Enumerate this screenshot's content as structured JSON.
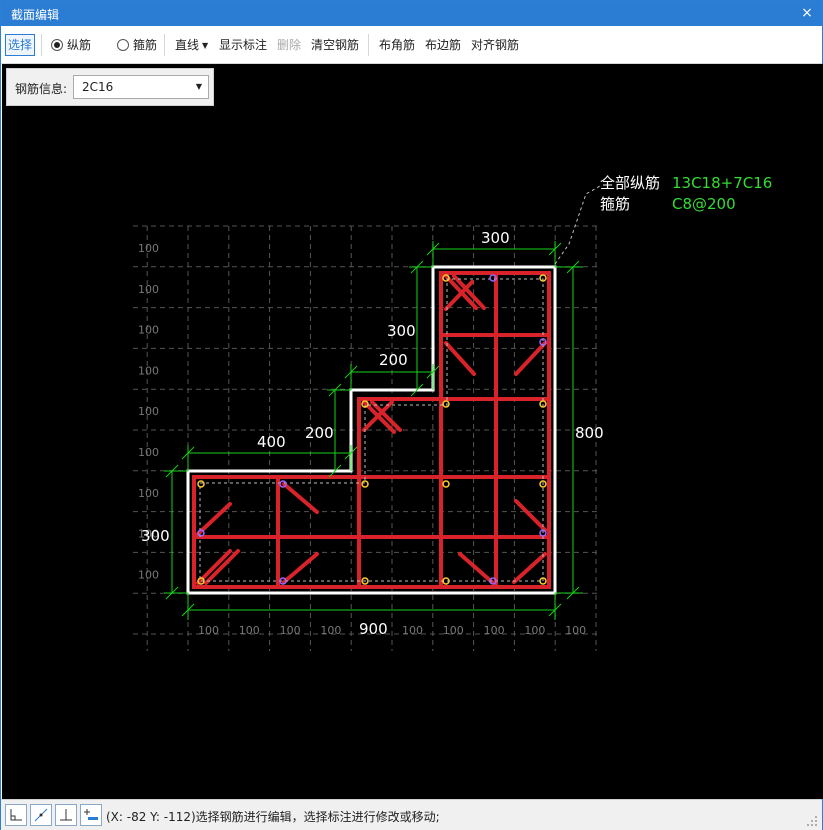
{
  "window": {
    "title": "截面编辑",
    "close": "×"
  },
  "toolbar": {
    "select": "选择",
    "longitudinal": "纵筋",
    "stirrup": "箍筋",
    "line": "直线",
    "show_dims": "显示标注",
    "delete": "删除",
    "clear": "清空钢筋",
    "corner": "布角筋",
    "edge": "布边筋",
    "align": "对齐钢筋"
  },
  "info": {
    "label": "钢筋信息:",
    "value": "2C16"
  },
  "annotation": {
    "all_long_label": "全部纵筋",
    "all_long_value": "13C18+7C16",
    "stirrup_label": "箍筋",
    "stirrup_value": "C8@200"
  },
  "dims": {
    "top_width": "300",
    "upper_step_height": "300",
    "mid_step_width": "200",
    "mid_step_height": "200",
    "left_width": "400",
    "right_height": "800",
    "left_height": "300",
    "bottom_width": "900"
  },
  "grid": {
    "cell_label": "100",
    "left_label_count": 9,
    "bottom_label_count": 10
  },
  "status": {
    "text": "(X: -82 Y: -112)选择钢筋进行编辑，选择标注进行修改或移动;"
  },
  "colors": {
    "rebar": "#d8232a",
    "outline": "#ffffff",
    "dimension": "#19d119",
    "annotation_value": "#33dd33",
    "grid": "#555555",
    "accent": "#2b7cd3"
  }
}
